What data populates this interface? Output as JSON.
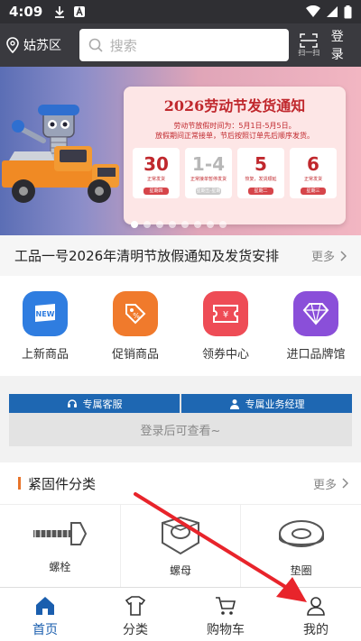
{
  "status": {
    "time": "4:09"
  },
  "header": {
    "location": "姑苏区",
    "search_placeholder": "搜索",
    "scan_label": "扫一扫",
    "login_label": "登录"
  },
  "banner": {
    "title": "2026劳动节发货通知",
    "body_line1": "劳动节放假时间为：5月1日-5月5日。",
    "body_line2": "放假期间正常接单，节后按照订单先后顺序发货。",
    "cards": [
      {
        "num": "30",
        "sub": "正常发货",
        "pill": "星期四",
        "gray": false
      },
      {
        "num": "1-4",
        "sub": "正常接单暂停发货",
        "pill": "星期五-星期一",
        "gray": true
      },
      {
        "num": "5",
        "sub": "恢复，发货顺延",
        "pill": "星期二",
        "gray": false
      },
      {
        "num": "6",
        "sub": "正常发货",
        "pill": "星期三",
        "gray": false
      }
    ]
  },
  "news": {
    "text": "工品一号2026年清明节放假通知及发货安排",
    "more": "更多"
  },
  "quick_menu": [
    {
      "label": "上新商品",
      "icon": "new-icon",
      "color": "#2f7de0"
    },
    {
      "label": "促销商品",
      "icon": "tag-icon",
      "color": "#f07a2c"
    },
    {
      "label": "领券中心",
      "icon": "coupon-icon",
      "color": "#ee4c56"
    },
    {
      "label": "进口品牌馆",
      "icon": "diamond-icon",
      "color": "#8a4fd9"
    }
  ],
  "service": {
    "tab1": "专属客服",
    "tab2": "专属业务经理",
    "message": "登录后可查看~"
  },
  "category": {
    "title": "紧固件分类",
    "more": "更多",
    "items": [
      {
        "label": "螺栓",
        "icon": "bolt-icon"
      },
      {
        "label": "螺母",
        "icon": "nut-icon"
      },
      {
        "label": "垫圈",
        "icon": "washer-icon"
      }
    ]
  },
  "tabbar": [
    {
      "label": "首页",
      "icon": "home-icon",
      "active": true
    },
    {
      "label": "分类",
      "icon": "shirt-icon",
      "active": false
    },
    {
      "label": "购物车",
      "icon": "cart-icon",
      "active": false
    },
    {
      "label": "我的",
      "icon": "person-icon",
      "active": false
    }
  ],
  "colors": {
    "primary": "#1e67b2",
    "header_bg": "#3a3a3f",
    "annotation_arrow": "#e8242b"
  }
}
